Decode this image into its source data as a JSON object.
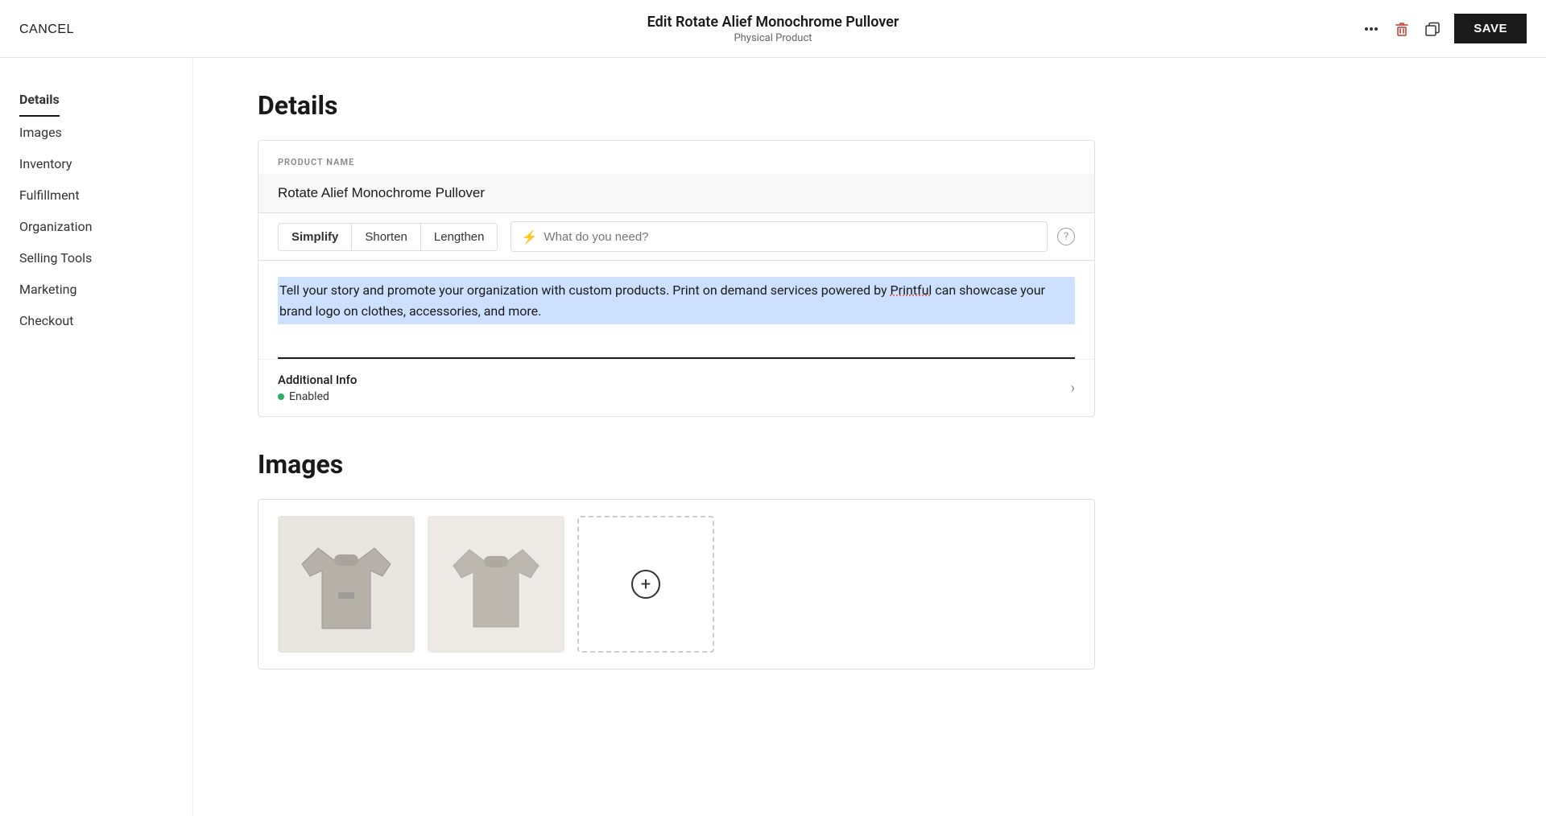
{
  "topbar": {
    "cancel_label": "CANCEL",
    "title": "Edit Rotate Alief Monochrome Pullover",
    "subtitle": "Physical Product",
    "save_label": "SAVE",
    "more_icon": "more-horizontal",
    "delete_icon": "trash",
    "duplicate_icon": "duplicate"
  },
  "sidebar": {
    "items": [
      {
        "id": "details",
        "label": "Details",
        "active": true
      },
      {
        "id": "images",
        "label": "Images",
        "active": false
      },
      {
        "id": "inventory",
        "label": "Inventory",
        "active": false
      },
      {
        "id": "fulfillment",
        "label": "Fulfillment",
        "active": false
      },
      {
        "id": "organization",
        "label": "Organization",
        "active": false
      },
      {
        "id": "selling-tools",
        "label": "Selling Tools",
        "active": false
      },
      {
        "id": "marketing",
        "label": "Marketing",
        "active": false
      },
      {
        "id": "checkout",
        "label": "Checkout",
        "active": false
      }
    ]
  },
  "details": {
    "section_title": "Details",
    "product_name_label": "PRODUCT NAME",
    "product_name_value": "Rotate Alief Monochrome Pullover",
    "ai_tabs": [
      {
        "id": "simplify",
        "label": "Simplify"
      },
      {
        "id": "shorten",
        "label": "Shorten"
      },
      {
        "id": "lengthen",
        "label": "Lengthen"
      }
    ],
    "ai_search_placeholder": "What do you need?",
    "description": "Tell your story and promote your organization with custom products. Print on demand services powered by Printful can showcase your brand logo on clothes, accessories, and more.",
    "underlined_word": "Printful",
    "additional_info": {
      "title": "Additional Info",
      "status": "Enabled"
    }
  },
  "images": {
    "section_title": "Images"
  }
}
